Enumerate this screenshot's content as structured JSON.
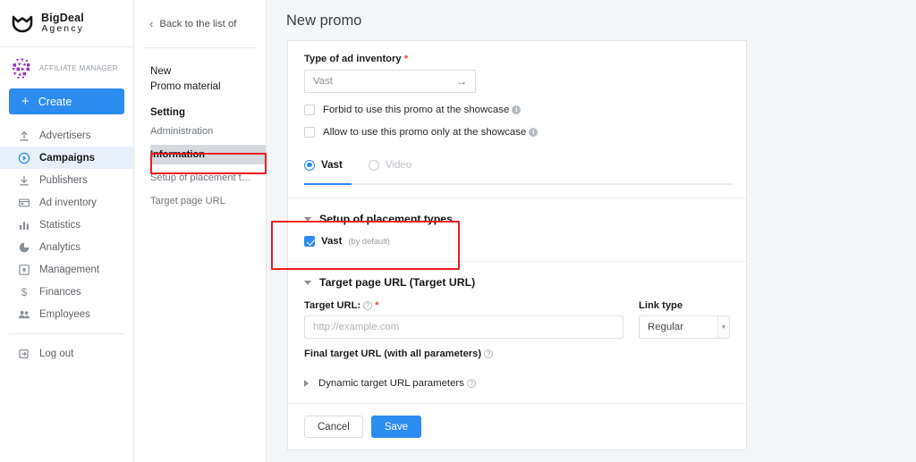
{
  "brand": {
    "name": "BigDeal",
    "sub": "Agency",
    "logo_icon": "shield-chevron-logo"
  },
  "account": {
    "role": "AFFILIATE MANAGER",
    "avatar_icon": "identicon-avatar",
    "create_label": "Create",
    "create_icon": "plus-icon",
    "accent_color": "#2d8cf0"
  },
  "sidebar": {
    "items": [
      {
        "label": "Advertisers",
        "icon": "upload-arrow-icon",
        "active": false
      },
      {
        "label": "Campaigns",
        "icon": "play-circle-icon",
        "active": true
      },
      {
        "label": "Publishers",
        "icon": "download-arrow-icon",
        "active": false
      },
      {
        "label": "Ad inventory",
        "icon": "card-icon",
        "active": false
      },
      {
        "label": "Statistics",
        "icon": "bar-chart-icon",
        "active": false
      },
      {
        "label": "Analytics",
        "icon": "pie-chart-icon",
        "active": false
      },
      {
        "label": "Management",
        "icon": "square-dot-icon",
        "active": false
      },
      {
        "label": "Finances",
        "icon": "dollar-icon",
        "active": false
      },
      {
        "label": "Employees",
        "icon": "people-icon",
        "active": false
      }
    ],
    "logout": {
      "label": "Log out",
      "icon": "logout-arrow-icon"
    },
    "active_color": "#e8f1fb"
  },
  "subpanel": {
    "back_label": "Back to the list of",
    "back_icon": "chevron-left-icon",
    "title_line1": "New",
    "title_line2": "Promo material",
    "group_label": "Setting",
    "items": [
      {
        "label": "Administration",
        "selected": false,
        "highlighted": false
      },
      {
        "label": "Information",
        "selected": true,
        "highlighted": false
      },
      {
        "label": "Setup of placement t…",
        "selected": false,
        "highlighted": true
      },
      {
        "label": "Target page URL",
        "selected": false,
        "highlighted": false
      }
    ]
  },
  "main": {
    "page_title": "New promo",
    "inventory": {
      "label": "Type of ad inventory",
      "required_mark": "*",
      "value": "Vast",
      "arrow_icon": "arrow-right-icon"
    },
    "checkboxes": [
      {
        "label": "Forbid to use this promo at the showcase",
        "checked": false,
        "info_icon": "info-icon"
      },
      {
        "label": "Allow to use this promo only at the showcase",
        "checked": false,
        "info_icon": "info-icon"
      }
    ],
    "format_tabs": [
      {
        "label": "Vast",
        "selected": true
      },
      {
        "label": "Video",
        "selected": false
      }
    ],
    "placement": {
      "title": "Setup of placement types",
      "caret_icon": "caret-down-icon",
      "option_label": "Vast",
      "option_note": "(by default)",
      "option_checked": true
    },
    "target": {
      "title": "Target page URL (Target URL)",
      "caret_icon": "caret-down-icon",
      "url_label": "Target URL:",
      "url_required": "*",
      "url_placeholder": "http://example.com",
      "url_value": "",
      "url_info_icon": "help-circle-icon",
      "link_type_label": "Link type",
      "link_type_value": "Regular",
      "link_type_options": [
        "Regular"
      ],
      "final_url_label": "Final target URL (with all parameters)",
      "final_url_info_icon": "help-circle-icon",
      "dynamic_label": "Dynamic target URL parameters",
      "dynamic_caret_icon": "caret-right-icon",
      "dynamic_info_icon": "help-circle-icon"
    },
    "footer": {
      "cancel_label": "Cancel",
      "save_label": "Save"
    }
  },
  "annotations": {
    "highlight_color": "#ec1c24",
    "boxes": [
      {
        "name": "setup-of-placement-types-nav-highlight"
      },
      {
        "name": "setup-of-placement-types-section-highlight"
      }
    ]
  }
}
